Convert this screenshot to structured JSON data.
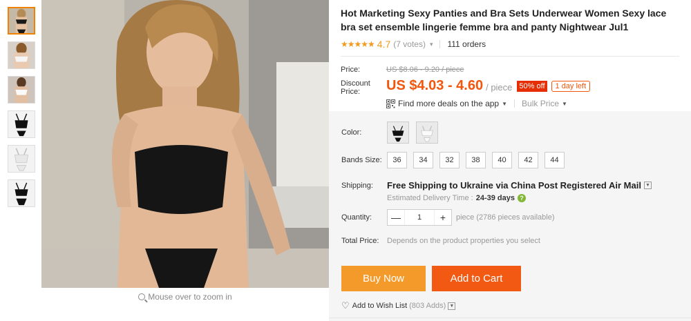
{
  "product": {
    "title": "Hot Marketing Sexy Panties and Bra Sets Underwear Women Sexy lace bra set ensemble lingerie femme bra and panty Nightwear Jul1",
    "stars": "★★★★★",
    "rating": "4.7",
    "votes": "(7 votes)",
    "votes_caret": "▾",
    "orders": "111 orders"
  },
  "gallery": {
    "zoom_hint": "Mouse over to zoom in",
    "thumbnails": [
      "thumb-1",
      "thumb-2",
      "thumb-3",
      "thumb-4",
      "thumb-5",
      "thumb-6"
    ]
  },
  "price": {
    "label": "Price:",
    "original": "US $8.06 - 9.20 / piece",
    "discount_label": "Discount Price:",
    "discount_label_line1": "Discount",
    "discount_label_line2": "Price:",
    "current": "US $4.03 - 4.60",
    "per_piece": "/ piece",
    "off_badge": "50% off",
    "time_badge": "1 day left",
    "app_deals": "Find more deals on the app",
    "bulk_price": "Bulk Price",
    "caret": "▼"
  },
  "options": {
    "color_label": "Color:",
    "bands_label": "Bands Size:",
    "sizes": [
      "36",
      "34",
      "32",
      "38",
      "40",
      "42",
      "44"
    ]
  },
  "shipping": {
    "label": "Shipping:",
    "text": "Free Shipping to Ukraine via China Post Registered Air Mail",
    "caret": "▼",
    "est_label": "Estimated Delivery Time :",
    "est_days": "24-39 days",
    "help": "?"
  },
  "quantity": {
    "label": "Quantity:",
    "minus": "—",
    "value": "1",
    "plus": "+",
    "note": "piece (2786 pieces available)"
  },
  "total": {
    "label": "Total Price:",
    "note": "Depends on the product properties you select"
  },
  "actions": {
    "buy_now": "Buy Now",
    "add_to_cart": "Add to Cart",
    "heart": "♡",
    "wishlist": "Add to Wish List",
    "wishlist_count": "(803 Adds)",
    "wishlist_caret": "▼"
  },
  "colors": {
    "accent_orange": "#f2550b",
    "buy_now_bg": "#f49a2a",
    "add_to_cart_bg": "#f25a14",
    "star": "#f29a1f",
    "off_badge_bg": "#e62e04",
    "help_green": "#81b735"
  }
}
